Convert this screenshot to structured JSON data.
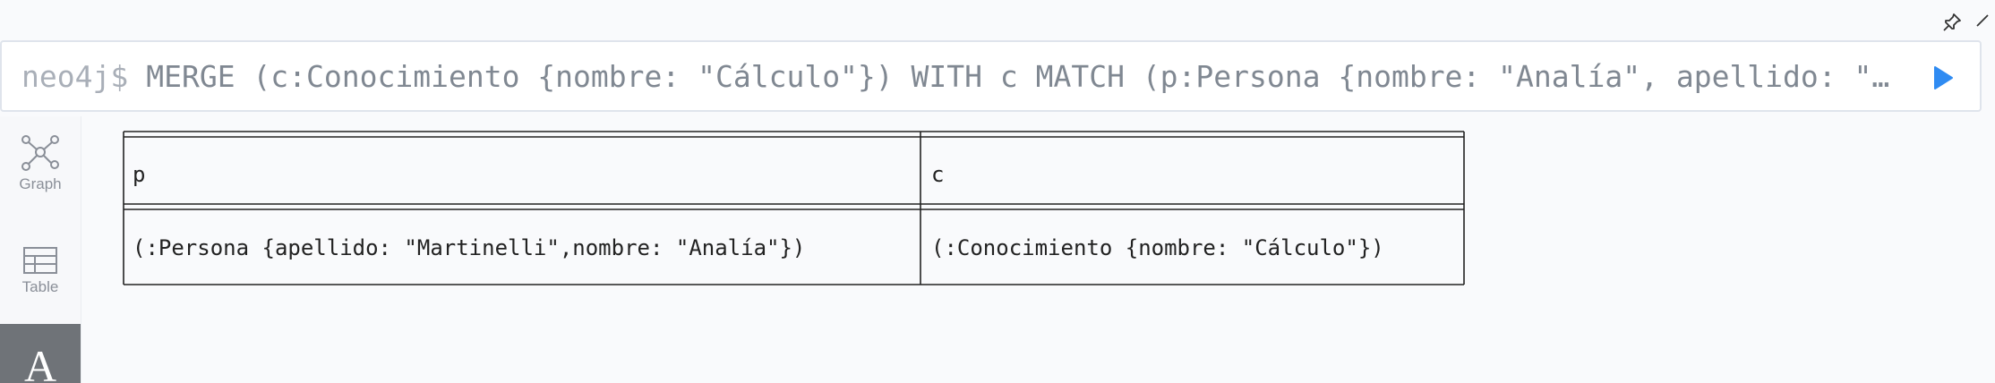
{
  "editor": {
    "prompt": "neo4j$",
    "query": "MERGE (c:Conocimiento {nombre: \"Cálculo\"}) WITH c MATCH (p:Persona {nombre: \"Analía\", apellido: \"Martinelli\"}) MERGE (p)-[:CONOCE]->(c) RETURN p, c"
  },
  "sidebar": {
    "items": [
      {
        "label": "Graph"
      },
      {
        "label": "Table"
      },
      {
        "label": "A"
      }
    ]
  },
  "table": {
    "headers": [
      "p",
      "c"
    ],
    "rows": [
      [
        "(:Persona {apellido: \"Martinelli\",nombre: \"Analía\"})",
        "(:Conocimiento {nombre: \"Cálculo\"})"
      ]
    ]
  },
  "colors": {
    "accent": "#2f8bf2",
    "background": "#f9fafc",
    "sidebar_active": "#6f7378"
  }
}
